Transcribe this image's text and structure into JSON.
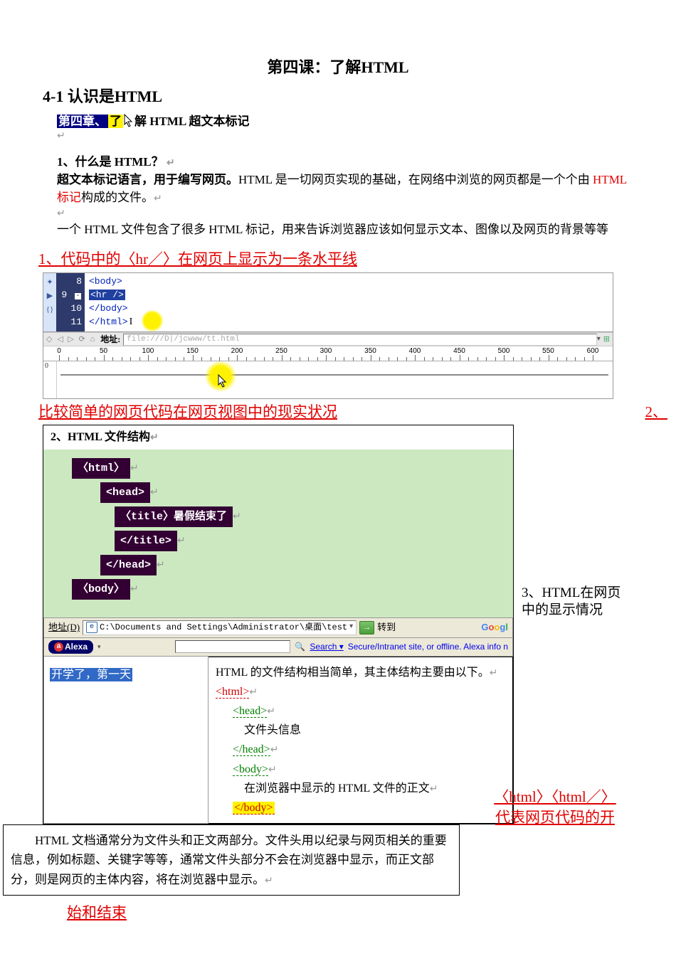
{
  "title": "第四课：了解HTML",
  "section41": "4-1 认识是HTML",
  "chapter": {
    "pre": "第四章、",
    "yellow": "了",
    "rest": "解 HTML 超文本标记"
  },
  "q1": "1、什么是 HTML？",
  "a1_bold": "超文本标记语言，用于编写网页。",
  "a1_rest1": "HTML 是一切网页实现的基础，在网络中浏览的网页都是一个个由 ",
  "a1_red": "HTML 标记",
  "a1_rest2": "构成的文件。",
  "a2": "一个 HTML 文件包含了很多 HTML 标记，用来告诉浏览器应该如何显示文本、图像以及网页的背景等等",
  "ann1": "1、代码中的〈hr／〉在网页上显示为一条水平线",
  "code": {
    "lines": [
      "8",
      "9",
      "10",
      "11"
    ],
    "l8": "<body>",
    "l9": "<hr />",
    "l10": "</body>",
    "l11": "</html>"
  },
  "toolbar": {
    "addr_label": "地址:",
    "addr_value": "file:///D|/jcwww/tt.html"
  },
  "ruler": [
    0,
    50,
    100,
    150,
    200,
    250,
    300,
    350,
    400,
    450,
    500,
    550,
    600
  ],
  "ann2_num": "2、",
  "ann2": "比较简单的网页代码在网页视图中的现实状况",
  "struct_title": "2、HTML 文件结构",
  "tags": {
    "html_open": "〈html〉",
    "head_open": "<head>",
    "title": "〈title〉暑假结束了",
    "title_close": "</title>",
    "head_close": "</head>",
    "body_open": "〈body〉"
  },
  "browser": {
    "addr_lbl": "地址(D)",
    "url": "C:\\Documents and Settings\\Administrator\\桌面\\test",
    "go": "→",
    "go_lbl": "转到"
  },
  "alexa": {
    "name": "Alexa",
    "search": "Search",
    "info": "Secure/Intranet site, or offline. Alexa info n"
  },
  "selected": "开学了，第一天",
  "explain": {
    "line1": "HTML 的文件结构相当简单，其主体结构主要由以下。",
    "html_o": "<html>",
    "head_o": "<head>",
    "head_info": "文件头信息",
    "head_c": "</head>",
    "body_o": "<body>",
    "body_info": "在浏览器中显示的 HTML 文件的正文",
    "body_c": "</body>"
  },
  "side_note": "3、HTML在网页中的显示情况",
  "bottom_box": "　　HTML 文档通常分为文件头和正文两部分。文件头用以纪录与网页相关的重要信息，例如标题、关键字等等，通常文件头部分不会在浏览器中显示，而正文部分，则是网页的主体内容，将在浏览器中显示。",
  "right_note_l1": "〈html〉〈html／〉",
  "right_note_l2": "代表网页代码的开",
  "final": "始和结束"
}
